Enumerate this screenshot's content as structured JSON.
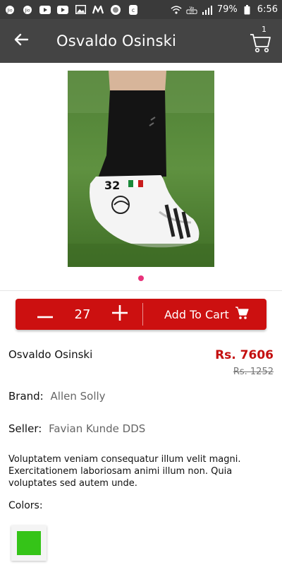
{
  "status_bar": {
    "battery": "79%",
    "time": "6:56",
    "icons_left": [
      "jio-icon",
      "jio-icon",
      "youtube-icon",
      "youtube-icon",
      "gallery-icon",
      "myntra-icon",
      "record-icon",
      "phone-icon"
    ],
    "icons_right": [
      "wifi-icon",
      "volte-icon",
      "signal-icon",
      "battery-icon"
    ]
  },
  "app_bar": {
    "title": "Osvaldo Osinski",
    "cart_count": "1",
    "back_icon": "arrow-left-icon",
    "cart_icon": "cart-icon"
  },
  "product": {
    "image_alt": "soccer cleat on grass",
    "name": "Osvaldo Osinski",
    "price": "Rs. 7606",
    "old_price": "Rs. 1252",
    "brand_label": "Brand:",
    "brand": "Allen Solly",
    "seller_label": "Seller:",
    "seller": "Favian Kunde DDS",
    "description": "Voluptatem veniam consequatur illum velit magni. Exercitationem laboriosam animi illum non. Quia voluptates sed autem unde.",
    "colors_label": "Colors:",
    "colors": [
      "#35c418"
    ]
  },
  "cart_control": {
    "quantity": "27",
    "add_to_cart_label": "Add To Cart"
  },
  "colors": {
    "status_bar": "#3a3a3a",
    "app_bar": "#444444",
    "accent_red": "#cc1010",
    "price_red": "#c40f0f",
    "dot_pink": "#e8327a"
  }
}
